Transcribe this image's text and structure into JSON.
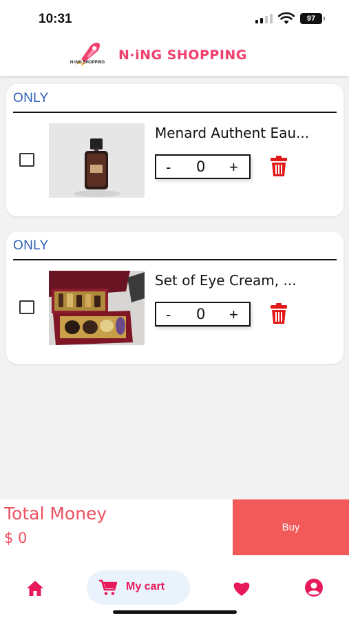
{
  "status_bar": {
    "time": "10:31",
    "battery": "97"
  },
  "header": {
    "logo_text": "N·iNG SHOPPING",
    "title": "N·iNG SHOPPING",
    "logo_icon": "rocket-icon"
  },
  "cart": {
    "items": [
      {
        "shop_label": "ONLY",
        "name": "Menard Authent Eau...",
        "quantity": "0",
        "minus": "-",
        "plus": "+"
      },
      {
        "shop_label": "ONLY",
        "name": "Set of Eye Cream, ...",
        "quantity": "0",
        "minus": "-",
        "plus": "+"
      }
    ]
  },
  "footer": {
    "total_label": "Total Money",
    "total_value": "$ 0",
    "buy_label": "Buy"
  },
  "nav": {
    "cart_label": "My cart",
    "icons": [
      "home-icon",
      "cart-icon",
      "heart-icon",
      "account-icon"
    ]
  },
  "colors": {
    "brand": "#ef3f6d",
    "accent_blue": "#2e5fb5",
    "buy_button": "#f25a5a",
    "total_text": "#ee4f60",
    "nav_active": "#e8195a",
    "trash": "#e21a1a"
  }
}
